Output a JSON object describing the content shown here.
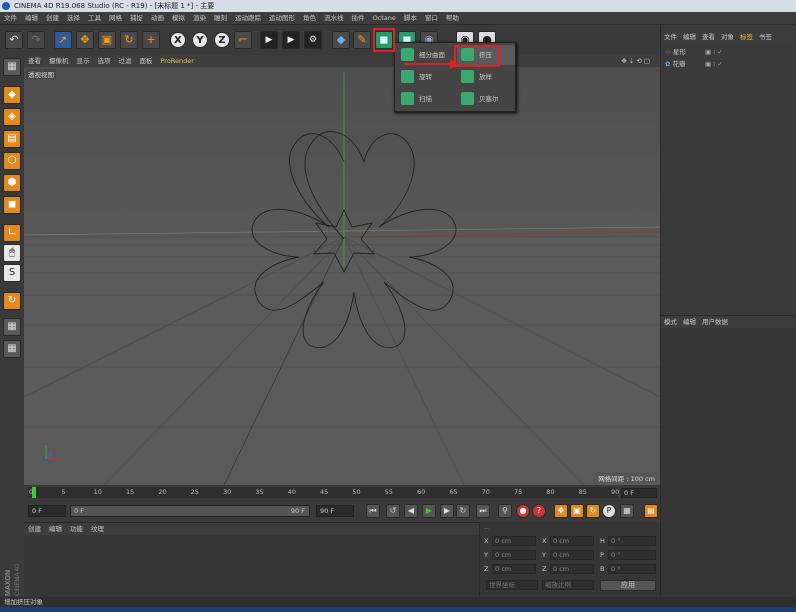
{
  "titlebar": {
    "title": "CINEMA 4D R19.068 Studio (RC - R19) - [未标题 1 *] - 主要"
  },
  "menubar": {
    "items": [
      "文件",
      "编辑",
      "创建",
      "选择",
      "工具",
      "网格",
      "捕捉",
      "动画",
      "模拟",
      "渲染",
      "雕刻",
      "运动跟踪",
      "运动图形",
      "角色",
      "流水线",
      "插件",
      "Octane",
      "脚本",
      "窗口",
      "帮助"
    ]
  },
  "toolbar": {
    "x_label": "X",
    "y_label": "Y",
    "z_label": "Z"
  },
  "dropdown": {
    "items": [
      {
        "label": "细分曲面",
        "icon": "subdivision-surface-icon"
      },
      {
        "label": "挤压",
        "icon": "extrude-icon"
      },
      {
        "label": "旋转",
        "icon": "lathe-icon"
      },
      {
        "label": "放样",
        "icon": "loft-icon"
      },
      {
        "label": "扫描",
        "icon": "sweep-icon"
      },
      {
        "label": "贝塞尔",
        "icon": "bezier-icon"
      }
    ]
  },
  "viewport": {
    "menu": [
      "查看",
      "摄像机",
      "显示",
      "选项",
      "过滤",
      "面板",
      "ProRender"
    ],
    "label": "透视视图",
    "grid_label": "网格间距 : 100 cm"
  },
  "timeline": {
    "ticks": [
      "0",
      "5",
      "10",
      "15",
      "20",
      "25",
      "30",
      "35",
      "40",
      "45",
      "50",
      "55",
      "60",
      "65",
      "70",
      "75",
      "80",
      "85",
      "90"
    ],
    "end_frame": "0 F"
  },
  "playbar": {
    "start": "0 F",
    "current": "0 F",
    "end_slider": "90 F",
    "end": "90 F"
  },
  "anim_panel": {
    "tabs": [
      "创建",
      "编辑",
      "功能",
      "纹理"
    ]
  },
  "coords": {
    "header": "--",
    "rows": [
      {
        "a": "X",
        "av": "0 cm",
        "b": "X",
        "bv": "0 cm",
        "c": "H",
        "cv": "0 °"
      },
      {
        "a": "Y",
        "av": "0 cm",
        "b": "Y",
        "bv": "0 cm",
        "c": "P",
        "cv": "0 °"
      },
      {
        "a": "Z",
        "av": "0 cm",
        "b": "Z",
        "bv": "0 cm",
        "c": "B",
        "cv": "0 °"
      }
    ],
    "world": "世界坐标",
    "scale": "缩放比例",
    "apply": "应用"
  },
  "objects": {
    "menu": [
      "文件",
      "编辑",
      "查看",
      "对象",
      "标签",
      "书签"
    ],
    "active_tab": "标签",
    "items": [
      {
        "name": "星形"
      },
      {
        "name": "花瓣"
      }
    ]
  },
  "attributes": {
    "tabs": [
      "模式",
      "编辑",
      "用户数据"
    ]
  },
  "statusbar": {
    "text": "增加挤压对象"
  },
  "brand": {
    "line1": "MAXON",
    "line2": "CINEMA 4D"
  }
}
